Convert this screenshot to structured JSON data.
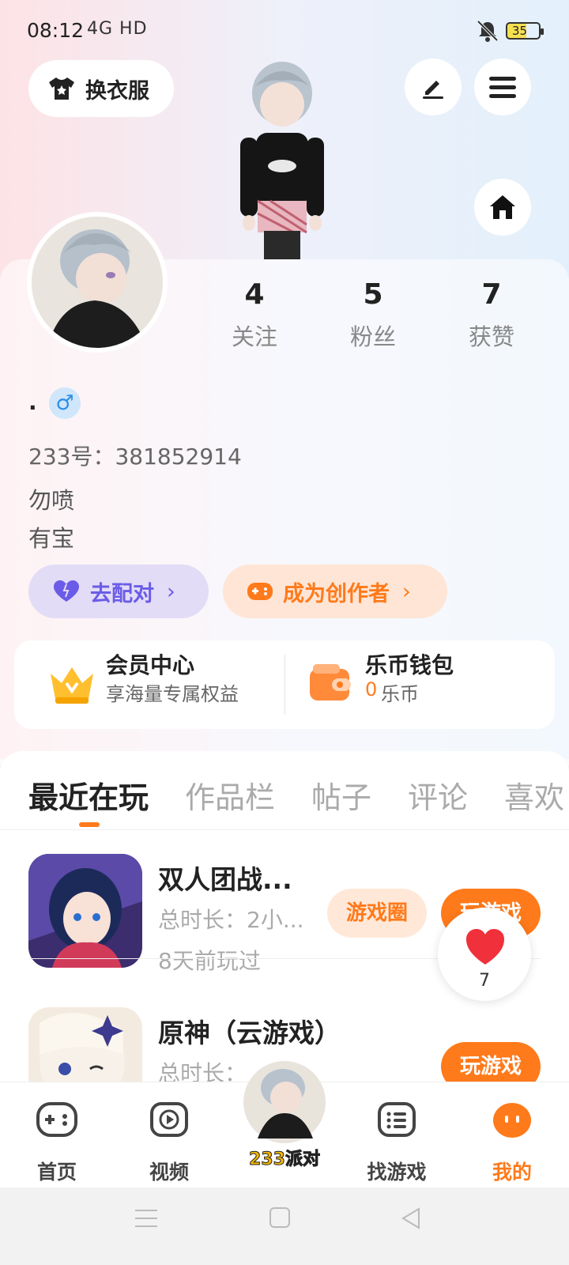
{
  "status_bar": {
    "time": "08:12",
    "network": "4G HD",
    "battery": "35"
  },
  "header": {
    "dress_label": "换衣服"
  },
  "stats": [
    {
      "value": "4",
      "label": "关注"
    },
    {
      "value": "5",
      "label": "粉丝"
    },
    {
      "value": "7",
      "label": "获赞"
    }
  ],
  "profile": {
    "nickname": ".",
    "gender_symbol": "♂",
    "id_text": "233号：381852914",
    "bio_lines": [
      "勿喷",
      "有宝"
    ]
  },
  "actions": {
    "match_label": "去配对",
    "creator_label": "成为创作者"
  },
  "member": {
    "title": "会员中心",
    "subtitle": "享海量专属权益",
    "wallet_title": "乐币钱包",
    "wallet_amount": "0",
    "wallet_unit": "乐币"
  },
  "tabs": [
    "最近在玩",
    "作品栏",
    "帖子",
    "评论",
    "喜欢"
  ],
  "games": [
    {
      "name": "双人团战...",
      "duration": "总时长：2小...",
      "last_played": "8天前玩过",
      "circle_label": "游戏圈",
      "play_label": "玩游戏"
    },
    {
      "name": "原神（云游戏）",
      "duration": "总时长：",
      "last_played": "",
      "play_label": "玩游戏"
    }
  ],
  "float_like": {
    "count": "7"
  },
  "bottom_nav": [
    {
      "label": "首页"
    },
    {
      "label": "视频"
    },
    {
      "label": "233派对"
    },
    {
      "label": "找游戏"
    },
    {
      "label": "我的"
    }
  ],
  "colors": {
    "accent": "#ff7a1a",
    "purple": "#6b5ce7"
  }
}
